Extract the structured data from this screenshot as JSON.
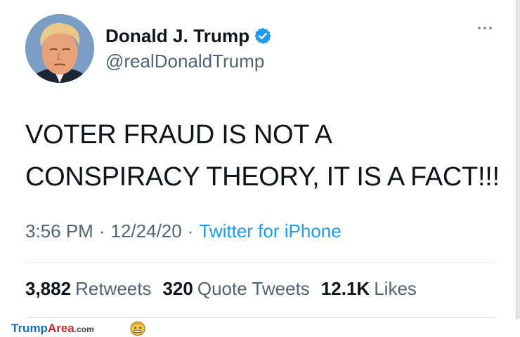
{
  "user": {
    "display_name": "Donald J. Trump",
    "handle": "@realDonaldTrump",
    "verified": true
  },
  "tweet": {
    "text_line1": "VOTER FRAUD IS NOT A",
    "text_line2": "CONSPIRACY THEORY, IT IS A FACT!!!",
    "time": "3:56 PM",
    "date": "12/24/20",
    "separator": "·",
    "source": "Twitter for iPhone"
  },
  "stats": {
    "retweets_count": "3,882",
    "retweets_label": "Retweets",
    "quotes_count": "320",
    "quotes_label": "Quote Tweets",
    "likes_count": "12.1K",
    "likes_label": "Likes"
  },
  "watermark": {
    "part1": "Trump",
    "part2": "Area",
    "part3": ".com"
  },
  "colors": {
    "accent": "#1d9bf0",
    "text": "#0f1419",
    "secondary": "#536471"
  },
  "icons": [
    "verified-badge-icon",
    "more-options-icon"
  ]
}
